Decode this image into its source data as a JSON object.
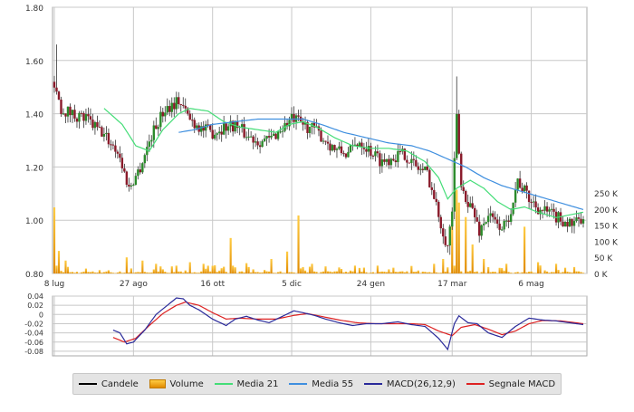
{
  "colors": {
    "up_candle": "#2a8a2a",
    "down_candle": "#8a1a2a",
    "volume": "#f5a623",
    "media21": "#44dd77",
    "media55": "#3f8fdf",
    "macd": "#2a2a9a",
    "signal": "#dd2222",
    "grid": "#c8c8c8"
  },
  "legend": [
    {
      "label": "Candele",
      "color": "#000000",
      "kind": "line"
    },
    {
      "label": "Volume",
      "color": "#f5a623",
      "kind": "box"
    },
    {
      "label": "Media 21",
      "color": "#44dd77",
      "kind": "line"
    },
    {
      "label": "Media 55",
      "color": "#3f8fdf",
      "kind": "line"
    },
    {
      "label": "MACD(26,12,9)",
      "color": "#2a2a9a",
      "kind": "line"
    },
    {
      "label": "Segnale MACD",
      "color": "#dd2222",
      "kind": "line"
    }
  ],
  "chart_data": [
    {
      "type": "candlestick",
      "x_ticks": [
        {
          "label": "8 lug",
          "i": 0
        },
        {
          "label": "27 ago",
          "i": 35
        },
        {
          "label": "16 ott",
          "i": 70
        },
        {
          "label": "5 dic",
          "i": 105
        },
        {
          "label": "24 gen",
          "i": 140
        },
        {
          "label": "17 mar",
          "i": 176
        },
        {
          "label": "6 mag",
          "i": 211
        }
      ],
      "ylim": [
        0.8,
        1.8
      ],
      "y_ticks": [
        "0.80",
        "1.00",
        "1.20",
        "1.40",
        "1.60",
        "1.80"
      ],
      "price_anchors": [
        [
          0,
          1.52
        ],
        [
          3,
          1.42
        ],
        [
          8,
          1.4
        ],
        [
          14,
          1.38
        ],
        [
          22,
          1.32
        ],
        [
          28,
          1.26
        ],
        [
          33,
          1.12
        ],
        [
          38,
          1.2
        ],
        [
          43,
          1.32
        ],
        [
          49,
          1.42
        ],
        [
          55,
          1.45
        ],
        [
          60,
          1.38
        ],
        [
          66,
          1.34
        ],
        [
          70,
          1.33
        ],
        [
          75,
          1.35
        ],
        [
          80,
          1.36
        ],
        [
          85,
          1.32
        ],
        [
          90,
          1.3
        ],
        [
          95,
          1.3
        ],
        [
          100,
          1.34
        ],
        [
          105,
          1.38
        ],
        [
          110,
          1.36
        ],
        [
          115,
          1.34
        ],
        [
          120,
          1.3
        ],
        [
          125,
          1.26
        ],
        [
          130,
          1.25
        ],
        [
          135,
          1.3
        ],
        [
          140,
          1.26
        ],
        [
          145,
          1.22
        ],
        [
          150,
          1.24
        ],
        [
          155,
          1.25
        ],
        [
          160,
          1.2
        ],
        [
          165,
          1.18
        ],
        [
          170,
          1.02
        ],
        [
          174,
          0.9
        ],
        [
          176,
          1.04
        ],
        [
          178,
          1.38
        ],
        [
          180,
          1.12
        ],
        [
          185,
          1.04
        ],
        [
          188,
          0.96
        ],
        [
          192,
          1.02
        ],
        [
          196,
          0.98
        ],
        [
          200,
          0.98
        ],
        [
          205,
          1.15
        ],
        [
          210,
          1.08
        ],
        [
          215,
          1.04
        ],
        [
          220,
          1.02
        ],
        [
          225,
          1.0
        ],
        [
          230,
          0.98
        ],
        [
          233,
          1.0
        ],
        [
          234,
          0.98
        ]
      ],
      "ma21_anchors": [
        [
          22,
          1.42
        ],
        [
          30,
          1.36
        ],
        [
          36,
          1.28
        ],
        [
          42,
          1.26
        ],
        [
          48,
          1.34
        ],
        [
          55,
          1.4
        ],
        [
          60,
          1.42
        ],
        [
          68,
          1.41
        ],
        [
          75,
          1.37
        ],
        [
          82,
          1.35
        ],
        [
          90,
          1.34
        ],
        [
          98,
          1.33
        ],
        [
          104,
          1.36
        ],
        [
          110,
          1.37
        ],
        [
          116,
          1.35
        ],
        [
          124,
          1.31
        ],
        [
          132,
          1.28
        ],
        [
          140,
          1.27
        ],
        [
          148,
          1.27
        ],
        [
          156,
          1.26
        ],
        [
          164,
          1.22
        ],
        [
          170,
          1.16
        ],
        [
          174,
          1.08
        ],
        [
          178,
          1.12
        ],
        [
          184,
          1.15
        ],
        [
          190,
          1.12
        ],
        [
          196,
          1.07
        ],
        [
          202,
          1.04
        ],
        [
          208,
          1.05
        ],
        [
          214,
          1.03
        ],
        [
          222,
          1.01
        ],
        [
          234,
          1.03
        ]
      ],
      "ma55_anchors": [
        [
          55,
          1.33
        ],
        [
          62,
          1.34
        ],
        [
          70,
          1.36
        ],
        [
          80,
          1.37
        ],
        [
          90,
          1.38
        ],
        [
          100,
          1.38
        ],
        [
          110,
          1.38
        ],
        [
          118,
          1.36
        ],
        [
          128,
          1.33
        ],
        [
          138,
          1.31
        ],
        [
          148,
          1.29
        ],
        [
          158,
          1.28
        ],
        [
          166,
          1.26
        ],
        [
          174,
          1.23
        ],
        [
          182,
          1.2
        ],
        [
          190,
          1.16
        ],
        [
          198,
          1.13
        ],
        [
          206,
          1.11
        ],
        [
          214,
          1.09
        ],
        [
          222,
          1.07
        ],
        [
          234,
          1.04
        ]
      ],
      "volume_axis": {
        "labels": [
          "0 K",
          "50 K",
          "100 K",
          "150 K",
          "200 K",
          "250 K"
        ],
        "max": 250
      }
    },
    {
      "type": "line",
      "ylim": [
        -0.09,
        0.04
      ],
      "y_ticks": [
        "0.04",
        "0.02",
        "0",
        "-0.02",
        "-0.04",
        "-0.06",
        "-0.08"
      ],
      "macd_anchors": [
        [
          26,
          -0.034
        ],
        [
          29,
          -0.04
        ],
        [
          32,
          -0.064
        ],
        [
          35,
          -0.06
        ],
        [
          40,
          -0.034
        ],
        [
          45,
          0.0
        ],
        [
          50,
          0.02
        ],
        [
          54,
          0.036
        ],
        [
          57,
          0.034
        ],
        [
          60,
          0.02
        ],
        [
          64,
          0.01
        ],
        [
          70,
          -0.01
        ],
        [
          76,
          -0.024
        ],
        [
          80,
          -0.01
        ],
        [
          85,
          -0.004
        ],
        [
          90,
          -0.012
        ],
        [
          95,
          -0.018
        ],
        [
          100,
          -0.006
        ],
        [
          106,
          0.008
        ],
        [
          110,
          0.004
        ],
        [
          115,
          -0.002
        ],
        [
          120,
          -0.01
        ],
        [
          126,
          -0.018
        ],
        [
          132,
          -0.024
        ],
        [
          138,
          -0.02
        ],
        [
          145,
          -0.02
        ],
        [
          152,
          -0.016
        ],
        [
          158,
          -0.022
        ],
        [
          164,
          -0.026
        ],
        [
          170,
          -0.052
        ],
        [
          174,
          -0.076
        ],
        [
          177,
          -0.02
        ],
        [
          179,
          -0.003
        ],
        [
          183,
          -0.018
        ],
        [
          187,
          -0.02
        ],
        [
          192,
          -0.04
        ],
        [
          198,
          -0.05
        ],
        [
          204,
          -0.026
        ],
        [
          210,
          -0.008
        ],
        [
          216,
          -0.012
        ],
        [
          222,
          -0.014
        ],
        [
          228,
          -0.018
        ],
        [
          234,
          -0.022
        ]
      ],
      "signal_anchors": [
        [
          26,
          -0.05
        ],
        [
          31,
          -0.06
        ],
        [
          36,
          -0.052
        ],
        [
          42,
          -0.024
        ],
        [
          48,
          0.002
        ],
        [
          54,
          0.02
        ],
        [
          58,
          0.027
        ],
        [
          64,
          0.02
        ],
        [
          70,
          0.004
        ],
        [
          76,
          -0.01
        ],
        [
          82,
          -0.008
        ],
        [
          90,
          -0.01
        ],
        [
          98,
          -0.01
        ],
        [
          106,
          -0.002
        ],
        [
          112,
          0.002
        ],
        [
          118,
          -0.004
        ],
        [
          126,
          -0.012
        ],
        [
          134,
          -0.018
        ],
        [
          142,
          -0.02
        ],
        [
          150,
          -0.02
        ],
        [
          158,
          -0.02
        ],
        [
          164,
          -0.022
        ],
        [
          170,
          -0.036
        ],
        [
          176,
          -0.046
        ],
        [
          180,
          -0.028
        ],
        [
          186,
          -0.022
        ],
        [
          192,
          -0.032
        ],
        [
          198,
          -0.044
        ],
        [
          204,
          -0.036
        ],
        [
          210,
          -0.02
        ],
        [
          216,
          -0.013
        ],
        [
          224,
          -0.014
        ],
        [
          234,
          -0.02
        ]
      ]
    }
  ]
}
